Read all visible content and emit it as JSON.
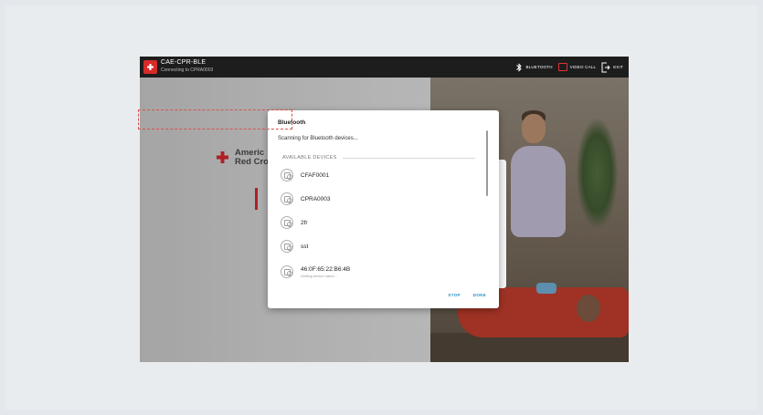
{
  "app": {
    "title": "CAE-CPR-BLE",
    "subtitle": "Connecting to CPRA0003"
  },
  "topbar": {
    "bluetooth_label": "BLUETOOTH",
    "video_call_label": "VIDEO CALL",
    "exit_label": "EXIT"
  },
  "brand": {
    "line1": "Americ",
    "line2": "Red Cro"
  },
  "dialog": {
    "title": "Bluetooth",
    "status": "Scanning for Bluetooth devices...",
    "section_label": "AVAILABLE DEVICES",
    "devices": [
      {
        "name": "CFAF0001",
        "sub": ""
      },
      {
        "name": "CPRA0003",
        "sub": ""
      },
      {
        "name": "2fr",
        "sub": ""
      },
      {
        "name": "sst",
        "sub": ""
      },
      {
        "name": "46:0F:65:22:B6:4B",
        "sub": "Getting device name..."
      }
    ],
    "stop_label": "STOP",
    "done_label": "DONE"
  },
  "colors": {
    "accent": "#2a8fc4",
    "brand_red": "#c8242a",
    "highlight": "#d9534f"
  }
}
